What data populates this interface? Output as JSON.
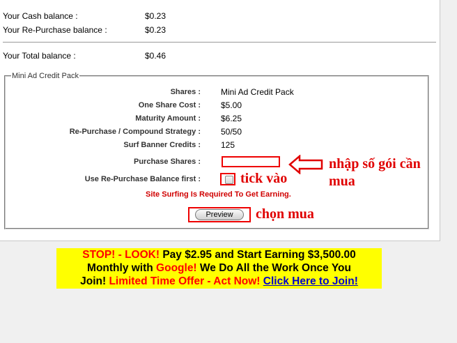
{
  "balances": {
    "cash_label": "Your Cash balance :",
    "cash_value": "$0.23",
    "repurchase_label": "Your Re-Purchase balance :",
    "repurchase_value": "$0.23",
    "total_label": "Your Total balance :",
    "total_value": "$0.46"
  },
  "pack": {
    "legend": "Mini Ad Credit Pack",
    "rows": [
      {
        "label": "Shares :",
        "value": "Mini Ad Credit Pack"
      },
      {
        "label": "One Share Cost :",
        "value": "$5.00"
      },
      {
        "label": "Maturity Amount :",
        "value": "$6.25"
      },
      {
        "label": "Re-Purchase / Compound Strategy :",
        "value": "50/50"
      },
      {
        "label": "Surf Banner Credits :",
        "value": "125"
      }
    ],
    "purchase_label": "Purchase Shares :",
    "purchase_value": "",
    "use_balance_label": "Use Re-Purchase Balance first :",
    "requirement": "Site Surfing Is Required To Get Earning.",
    "preview_button": "Preview"
  },
  "annotations": {
    "input_note_line1": "nhập số gói cần",
    "input_note_line2": "mua",
    "checkbox_note": "tick vào",
    "button_note": "chọn mua"
  },
  "ad": {
    "l1_stop": "STOP! - LOOK!",
    "l1_rest": " Pay $2.95 and Start Earning $3,500.00",
    "l2_a": "Monthly with ",
    "l2_google": "Google!",
    "l2_b": " We Do All the Work Once You",
    "l3_join": "Join!",
    "l3_offer": " Limited Time Offer - Act Now! ",
    "l3_link": "Click Here to Join!"
  },
  "colors": {
    "annotation": "#e00000",
    "ad_background": "#ffff00",
    "ad_link": "#0000cc"
  }
}
